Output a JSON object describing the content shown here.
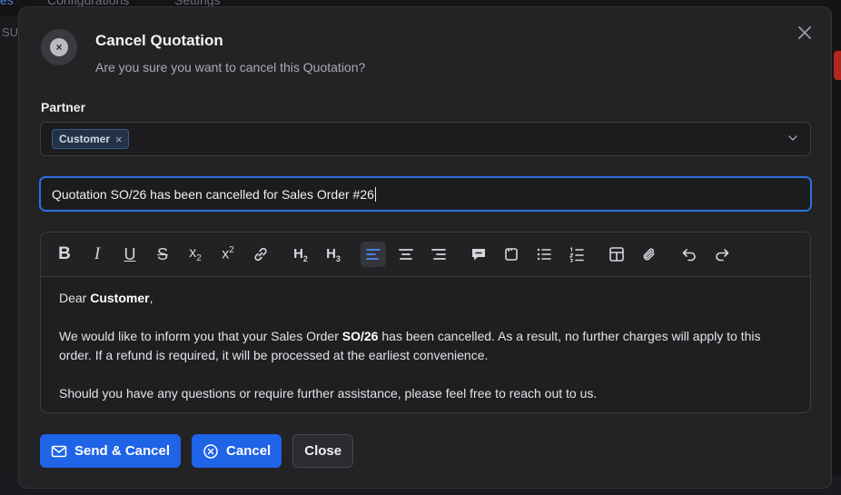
{
  "background": {
    "tabs": [
      "es",
      "Configurations",
      "Settings"
    ],
    "left_text": "SU"
  },
  "dialog": {
    "title": "Cancel Quotation",
    "subtitle": "Are you sure you want to cancel this Quotation?",
    "icon": "close-circle-icon",
    "close_icon": "close-icon"
  },
  "partner": {
    "label": "Partner",
    "selected_chips": [
      "Customer"
    ],
    "chip_remove": "×"
  },
  "subject": {
    "value": "Quotation SO/26 has been cancelled for Sales Order #26"
  },
  "toolbar": {
    "buttons": [
      {
        "name": "bold-icon",
        "glyph": "B"
      },
      {
        "name": "italic-icon",
        "glyph": "I"
      },
      {
        "name": "underline-icon",
        "glyph": "U"
      },
      {
        "name": "strikethrough-icon",
        "glyph": "S"
      },
      {
        "name": "subscript-icon",
        "glyph": "x₂"
      },
      {
        "name": "superscript-icon",
        "glyph": "x²"
      },
      {
        "name": "link-icon"
      },
      {
        "name": "heading2-icon",
        "glyph": "H₂"
      },
      {
        "name": "heading3-icon",
        "glyph": "H₃"
      },
      {
        "name": "align-left-icon",
        "active": true
      },
      {
        "name": "align-center-icon"
      },
      {
        "name": "align-right-icon"
      },
      {
        "name": "comment-icon"
      },
      {
        "name": "code-block-icon"
      },
      {
        "name": "bullet-list-icon"
      },
      {
        "name": "ordered-list-icon"
      },
      {
        "name": "table-icon"
      },
      {
        "name": "attachment-icon"
      },
      {
        "name": "undo-icon"
      },
      {
        "name": "redo-icon"
      }
    ],
    "accent": "#2f6fe0"
  },
  "body": {
    "greeting_prefix": "Dear ",
    "greeting_name": "Customer",
    "greeting_suffix": ",",
    "p1_before": "We would like to inform you that your Sales Order ",
    "p1_order": "SO/26",
    "p1_after": " has been cancelled. As a result, no further charges will apply to this order. If a refund is required, it will be processed at the earliest convenience.",
    "p2": "Should you have any questions or require further assistance, please feel free to reach out to us."
  },
  "footer": {
    "send_cancel_label": "Send & Cancel",
    "send_cancel_icon": "envelope-icon",
    "cancel_label": "Cancel",
    "cancel_icon": "close-circle-icon",
    "close_label": "Close",
    "primary_color": "#1f63e6"
  }
}
